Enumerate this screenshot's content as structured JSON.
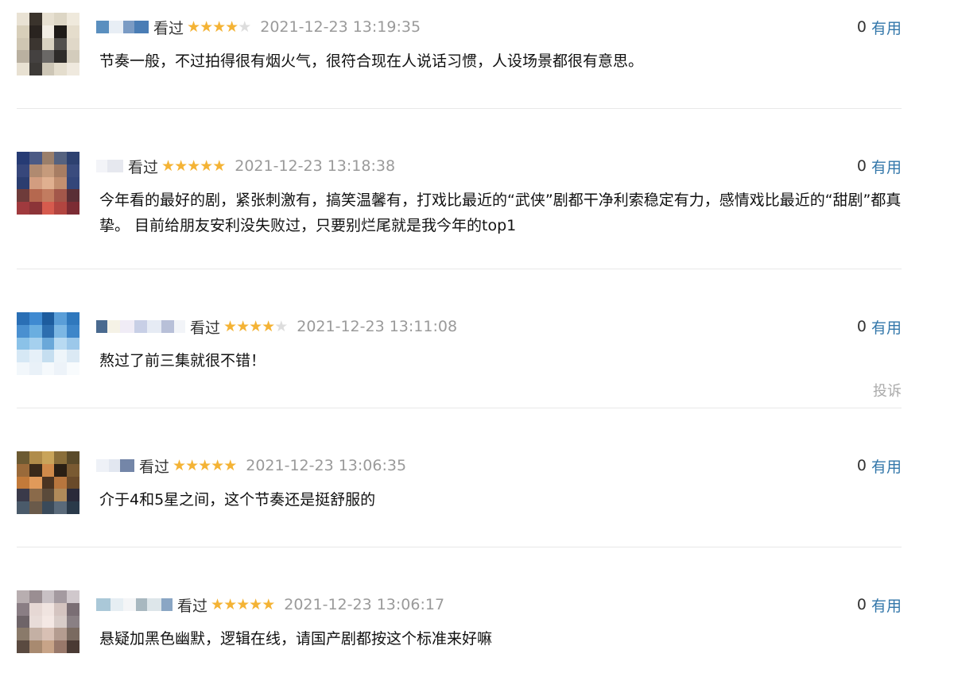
{
  "colors": {
    "star_on": "#f4b335",
    "star_off": "#dddddd",
    "link": "#3377aa",
    "meta": "#9a9a9a",
    "divider": "#e8e8e8"
  },
  "comments": [
    {
      "status": "看过",
      "rating": 4,
      "rating_max": 5,
      "time": "2021-12-23 13:19:35",
      "votes": "0",
      "useful_label": "有用",
      "content": "节奏一般，不过拍得很有烟火气，很符合现在人说话习惯，人设场景都很有意思。"
    },
    {
      "status": "看过",
      "rating": 5,
      "rating_max": 5,
      "time": "2021-12-23 13:18:38",
      "votes": "0",
      "useful_label": "有用",
      "content": "今年看的最好的剧，紧张刺激有，搞笑温馨有，打戏比最近的“武侠”剧都干净利索稳定有力，感情戏比最近的“甜剧”都真挚。 目前给朋友安利没失败过，只要别烂尾就是我今年的top1"
    },
    {
      "status": "看过",
      "rating": 4,
      "rating_max": 5,
      "time": "2021-12-23 13:11:08",
      "votes": "0",
      "useful_label": "有用",
      "content": "熬过了前三集就很不错！",
      "report_label": "投诉"
    },
    {
      "status": "看过",
      "rating": 5,
      "rating_max": 5,
      "time": "2021-12-23 13:06:35",
      "votes": "0",
      "useful_label": "有用",
      "content": "介于4和5星之间，这个节奏还是挺舒服的"
    },
    {
      "status": "看过",
      "rating": 5,
      "rating_max": 5,
      "time": "2021-12-23 13:06:17",
      "votes": "0",
      "useful_label": "有用",
      "content": "悬疑加黑色幽默，逻辑在线，请国产剧都按这个标准来好嘛"
    }
  ]
}
